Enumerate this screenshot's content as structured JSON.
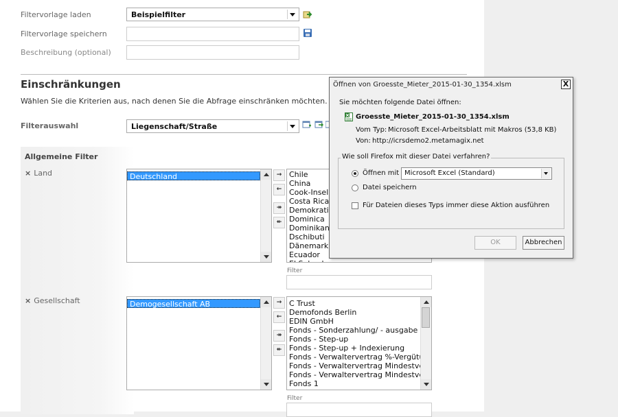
{
  "form": {
    "load_label": "Filtervorlage laden",
    "load_value": "Beispielfilter",
    "save_label": "Filtervorlage speichern",
    "save_value": "",
    "desc_label": "Beschreibung (optional)",
    "desc_value": ""
  },
  "section": {
    "title": "Einschränkungen",
    "description": "Wählen Sie die Kriterien aus, nach denen Sie die Abfrage einschränken möchten.",
    "filter_select_label": "Filterauswahl",
    "filter_select_value": "Liegenschaft/Straße"
  },
  "filters": {
    "panel_title": "Allgemeine Filter",
    "land": {
      "label": "Land",
      "selected": [
        "Deutschland"
      ],
      "available": [
        "Chile",
        "China",
        "Cook-Inseln",
        "Costa Rica",
        "Demokratisch",
        "Dominica",
        "Dominikanisc",
        "Dschibuti",
        "Dänemark",
        "Ecuador",
        "El Salvador"
      ],
      "filter_caption": "Filter",
      "filter_value": ""
    },
    "gesellschaft": {
      "label": "Gesellschaft",
      "selected": [
        "Demogesellschaft AB"
      ],
      "available": [
        "C Trust",
        "Demofonds Berlin",
        "EDIN GmbH",
        "Fonds - Sonderzahlung/ - ausgabe",
        "Fonds - Step-up",
        "Fonds - Step-up + Indexierung",
        "Fonds - Verwaltervertrag %-Vergütung",
        "Fonds - Verwaltervertrag Mindestvergütung",
        "Fonds - Verwaltervertrag Mindestvergütung (",
        "Fonds 1"
      ],
      "filter_caption": "Filter",
      "filter_value": ""
    },
    "move_buttons": {
      "add": "→",
      "remove": "←",
      "add_all": "↠",
      "remove_all": "↞"
    }
  },
  "dialog": {
    "title": "Öffnen von Groesste_Mieter_2015-01-30_1354.xlsm",
    "close": "X",
    "intro": "Sie möchten folgende Datei öffnen:",
    "filename": "Groesste_Mieter_2015-01-30_1354.xlsm",
    "type_label": "Vom Typ:",
    "type_value": "Microsoft Excel-Arbeitsblatt mit Makros (53,8 KB)",
    "from_label": "Von:",
    "from_value": "http://icrsdemo2.metamagix.net",
    "question": "Wie soll Firefox mit dieser Datei verfahren?",
    "open_with_label": "Öffnen mit",
    "open_with_value": "Microsoft Excel (Standard)",
    "save_label": "Datei speichern",
    "always_label": "Für Dateien dieses Typs immer diese Aktion ausführen",
    "ok_label": "OK",
    "cancel_label": "Abbrechen",
    "open_with_selected": true,
    "always_checked": false
  },
  "icons": {
    "load_go": "load-arrow-icon",
    "save_disk": "save-disk-icon",
    "filter_actions": [
      "filter-add-icon",
      "filter-edit-icon",
      "filter-more-icon"
    ],
    "excel_file": "excel-file-icon"
  },
  "colors": {
    "selection": "#3399ff",
    "page_bg": "#ffffff",
    "outer_bg": "#efefef"
  }
}
